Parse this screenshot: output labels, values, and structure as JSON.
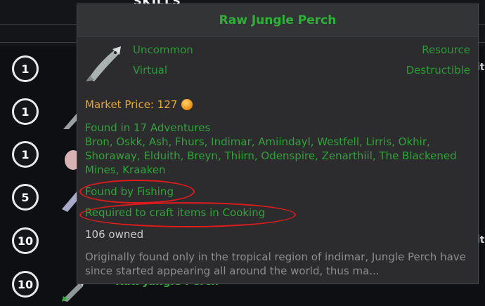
{
  "background": {
    "section_title": "SKILLS",
    "item_name": "Raw Jungle Perch",
    "badges": [
      "1",
      "1",
      "1",
      "5",
      "10",
      "10"
    ],
    "edge_fragments": [
      "it",
      "it"
    ]
  },
  "tooltip": {
    "title": "Raw Jungle Perch",
    "rarity": "Uncommon",
    "type": "Resource",
    "virtual": "Virtual",
    "destructible": "Destructible",
    "market_price": "Market Price: 127",
    "found_in": "Found in 17 Adventures",
    "adventures": "Bron, Oskk, Ash, Fhurs, Indimar, Amiindayl, Westfell, Lirris, Okhir, Shoraway, Elduith, Breyn, Thiirn, Odenspire, Zenarthiil, The Blackened Mines, Kraaken",
    "found_by": "Found by Fishing",
    "required": "Required to craft items in Cooking",
    "owned": "106 owned",
    "description": "Originally found only in the tropical region of indimar, Jungle Perch have since started appearing all around the world, thus ma..."
  },
  "colors": {
    "name_green": "#2fb039",
    "price_orange": "#e5a63b",
    "annotation_red": "#e11b1b"
  },
  "icons": [
    "fish-icon",
    "gold-coin-icon"
  ]
}
